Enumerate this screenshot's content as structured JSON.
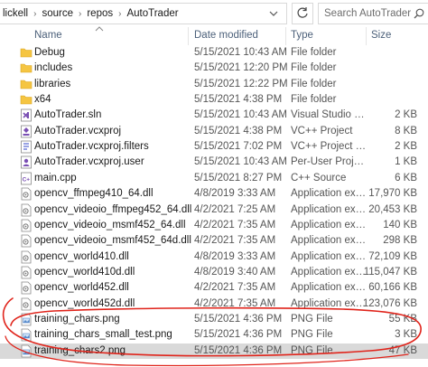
{
  "address_bar": {
    "crumbs": [
      "lickell",
      "source",
      "repos",
      "AutoTrader"
    ]
  },
  "search": {
    "placeholder": "Search AutoTrader"
  },
  "columns": {
    "name": "Name",
    "date": "Date modified",
    "type": "Type",
    "size": "Size"
  },
  "files": [
    {
      "name": "Debug",
      "date": "5/15/2021 10:43 AM",
      "type": "File folder",
      "size": "",
      "icon": "folder-icon"
    },
    {
      "name": "includes",
      "date": "5/15/2021 12:20 PM",
      "type": "File folder",
      "size": "",
      "icon": "folder-icon"
    },
    {
      "name": "libraries",
      "date": "5/15/2021 12:22 PM",
      "type": "File folder",
      "size": "",
      "icon": "folder-icon"
    },
    {
      "name": "x64",
      "date": "5/15/2021 4:38 PM",
      "type": "File folder",
      "size": "",
      "icon": "folder-icon"
    },
    {
      "name": "AutoTrader.sln",
      "date": "5/15/2021 10:43 AM",
      "type": "Visual Studio Solut...",
      "size": "2 KB",
      "icon": "solution-icon"
    },
    {
      "name": "AutoTrader.vcxproj",
      "date": "5/15/2021 4:38 PM",
      "type": "VC++ Project",
      "size": "8 KB",
      "icon": "vcxproj-icon"
    },
    {
      "name": "AutoTrader.vcxproj.filters",
      "date": "5/15/2021 7:02 PM",
      "type": "VC++ Project Filte...",
      "size": "2 KB",
      "icon": "filters-icon"
    },
    {
      "name": "AutoTrader.vcxproj.user",
      "date": "5/15/2021 10:43 AM",
      "type": "Per-User Project O...",
      "size": "1 KB",
      "icon": "user-file-icon"
    },
    {
      "name": "main.cpp",
      "date": "5/15/2021 8:27 PM",
      "type": "C++ Source",
      "size": "6 KB",
      "icon": "cpp-icon"
    },
    {
      "name": "opencv_ffmpeg410_64.dll",
      "date": "4/8/2019 3:33 AM",
      "type": "Application extens...",
      "size": "17,970 KB",
      "icon": "dll-icon"
    },
    {
      "name": "opencv_videoio_ffmpeg452_64.dll",
      "date": "4/2/2021 7:25 AM",
      "type": "Application extens...",
      "size": "20,453 KB",
      "icon": "dll-icon"
    },
    {
      "name": "opencv_videoio_msmf452_64.dll",
      "date": "4/2/2021 7:35 AM",
      "type": "Application extens...",
      "size": "140 KB",
      "icon": "dll-icon"
    },
    {
      "name": "opencv_videoio_msmf452_64d.dll",
      "date": "4/2/2021 7:35 AM",
      "type": "Application extens...",
      "size": "298 KB",
      "icon": "dll-icon"
    },
    {
      "name": "opencv_world410.dll",
      "date": "4/8/2019 3:33 AM",
      "type": "Application extens...",
      "size": "72,109 KB",
      "icon": "dll-icon"
    },
    {
      "name": "opencv_world410d.dll",
      "date": "4/8/2019 3:40 AM",
      "type": "Application extens...",
      "size": "115,047 KB",
      "icon": "dll-icon"
    },
    {
      "name": "opencv_world452.dll",
      "date": "4/2/2021 7:35 AM",
      "type": "Application extens...",
      "size": "60,166 KB",
      "icon": "dll-icon"
    },
    {
      "name": "opencv_world452d.dll",
      "date": "4/2/2021 7:35 AM",
      "type": "Application extens...",
      "size": "123,076 KB",
      "icon": "dll-icon"
    },
    {
      "name": "training_chars.png",
      "date": "5/15/2021 4:36 PM",
      "type": "PNG File",
      "size": "55 KB",
      "icon": "png-icon"
    },
    {
      "name": "training_chars_small_test.png",
      "date": "5/15/2021 4:36 PM",
      "type": "PNG File",
      "size": "3 KB",
      "icon": "png-icon"
    },
    {
      "name": "training_chars2.png",
      "date": "5/15/2021 4:36 PM",
      "type": "PNG File",
      "size": "47 KB",
      "icon": "png-icon"
    }
  ],
  "selected_index": 19,
  "colors": {
    "folder": "#f5c542",
    "selection": "#d9d9d9",
    "annotation": "#e0241b",
    "header_text": "#4c607a"
  }
}
